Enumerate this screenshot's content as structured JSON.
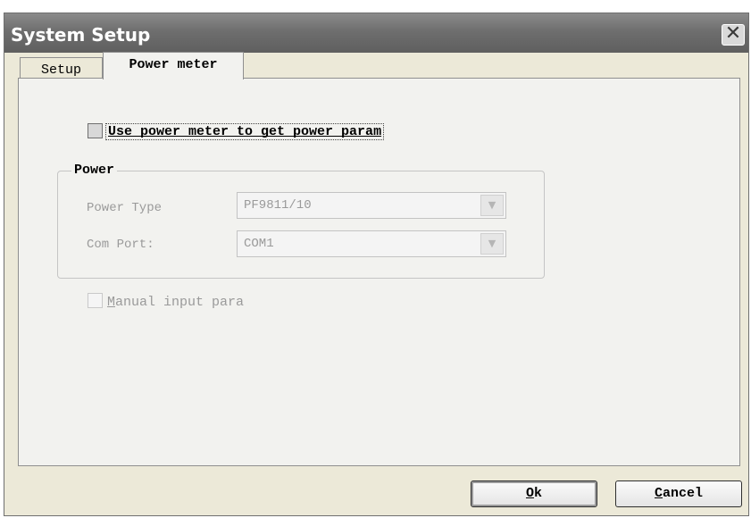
{
  "window": {
    "title": "System Setup",
    "close_glyph": "✕"
  },
  "tabs": [
    {
      "label": "Setup",
      "active": false
    },
    {
      "label": "Power meter",
      "active": true
    }
  ],
  "power_meter_tab": {
    "use_power_meter": {
      "mnemonic": "U",
      "label_rest": "se power meter to get power param",
      "checked": false
    },
    "power_group": {
      "legend": "Power",
      "power_type": {
        "label": "Power Type",
        "value": "PF9811/10",
        "enabled": false
      },
      "com_port": {
        "label": "Com Port:",
        "value": "COM1",
        "enabled": false
      }
    },
    "manual_input": {
      "mnemonic": "M",
      "label_rest": "anual input para",
      "checked": false,
      "enabled": false
    }
  },
  "buttons": {
    "ok": {
      "mnemonic": "O",
      "rest": "k"
    },
    "cancel": {
      "mnemonic": "C",
      "rest": "ancel"
    }
  },
  "icons": {
    "close": "close-icon",
    "dropdown": "chevron-down-icon"
  }
}
